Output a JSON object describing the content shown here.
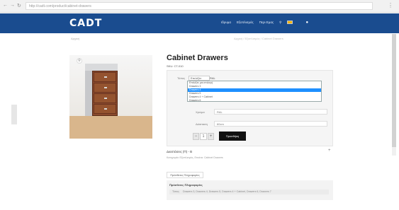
{
  "browser": {
    "url": "http://cadt.com/product/cabinet-drawers"
  },
  "header": {
    "logo": "CADT",
    "nav": [
      "Ιδρυμα",
      "Εξοπλισμός",
      "Περι Εμας"
    ],
    "flag_color": "#f4b400",
    "cart_icon": "cart-icon",
    "brand_color": "#1a4c8f"
  },
  "breadcrumb": {
    "left": "Αρχική",
    "right": "Αρχική / Εξοπλισμός / Cabinet Drawers"
  },
  "product": {
    "title": "Cabinet Drawers",
    "sku": "SKU: CT-010"
  },
  "options": {
    "type_label": "Τύπος",
    "select_current": "Επιλέξτε",
    "select_mid": "RAL",
    "dropdown_items": [
      "Επιλέξτε μια επιλογή",
      "Drawers 3",
      "Drawers 4",
      "Drawers 5",
      "Drawers 4 + Cabinet",
      "Drawers 6",
      "Drawers 7"
    ],
    "selected_index": 2,
    "field1_label": "Χρώμα",
    "field1_value": "RAL",
    "field2_label": "Διάσταση",
    "field2_value": "60cm",
    "qty": "1",
    "add_label": "Προσθήκη"
  },
  "description": {
    "title": "Διαστάσεις (Π) - Β",
    "toggle": "+",
    "sub": "Κατηγορία: Εξοπλισμός, Ετικέτα: Cabinet Drawers"
  },
  "tabs": {
    "info_tab": "Πρόσθετες Πληροφορίες"
  },
  "specs": {
    "heading": "Πρόσθετες Πληροφορίες",
    "row_label": "Τύπος",
    "row_value": "Drawers 3, Drawers 4, Drawers 5, Drawers 4 + Cabinet, Drawers 6, Drawers 7"
  }
}
